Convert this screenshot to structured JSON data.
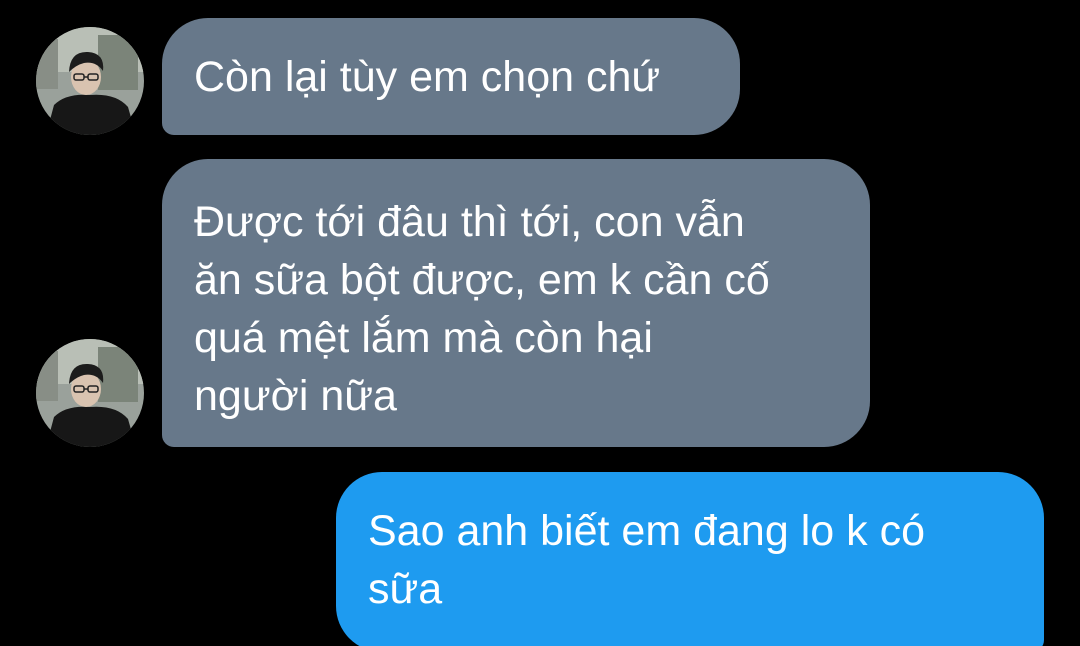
{
  "conversation": {
    "messages": [
      {
        "direction": "incoming",
        "text": "Còn lại tùy em chọn chứ"
      },
      {
        "direction": "incoming",
        "text": "Được tới đâu thì tới, con vẫn\năn sữa bột được, em k cần cố\nquá mệt lắm mà còn hại\nngười nữa"
      },
      {
        "direction": "outgoing",
        "text": "Sao anh biết em đang lo k có\nsữa"
      }
    ]
  },
  "colors": {
    "background": "#000000",
    "incoming_bubble": "#67788a",
    "outgoing_bubble": "#1e9bf0",
    "text": "#ffffff"
  },
  "icons": {
    "avatar": "contact-avatar-photo"
  }
}
